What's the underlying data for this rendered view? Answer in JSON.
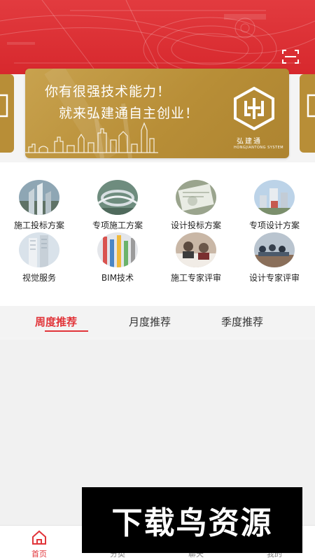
{
  "banner": {
    "line1": "你有很强技术能力！",
    "line2": "就来弘建通自主创业！",
    "logo_name": "弘建通",
    "logo_sub": "HONGJIANTONG SYSTEM"
  },
  "categories": [
    {
      "label": "施工投标方案",
      "icon": "building-photo"
    },
    {
      "label": "专项施工方案",
      "icon": "overpass-photo"
    },
    {
      "label": "设计投标方案",
      "icon": "blueprint-photo"
    },
    {
      "label": "专项设计方案",
      "icon": "city-photo"
    },
    {
      "label": "视觉服务",
      "icon": "tower-photo"
    },
    {
      "label": "BIM技术",
      "icon": "pipes-photo"
    },
    {
      "label": "施工专家评审",
      "icon": "meeting-photo"
    },
    {
      "label": "设计专家评审",
      "icon": "conference-photo"
    }
  ],
  "tabs": [
    {
      "label": "周度推荐",
      "active": true
    },
    {
      "label": "月度推荐",
      "active": false
    },
    {
      "label": "季度推荐",
      "active": false
    }
  ],
  "nav": [
    {
      "label": "首页",
      "icon": "home-icon",
      "active": true
    },
    {
      "label": "分类",
      "icon": "category-icon",
      "active": false
    },
    {
      "label": "聊天",
      "icon": "chat-icon",
      "active": false
    },
    {
      "label": "我的",
      "icon": "user-icon",
      "active": false
    }
  ],
  "watermark": "下载鸟资源",
  "colors": {
    "accent": "#e1353a",
    "header": "#d7282d",
    "banner_gold": "#b88e37"
  }
}
